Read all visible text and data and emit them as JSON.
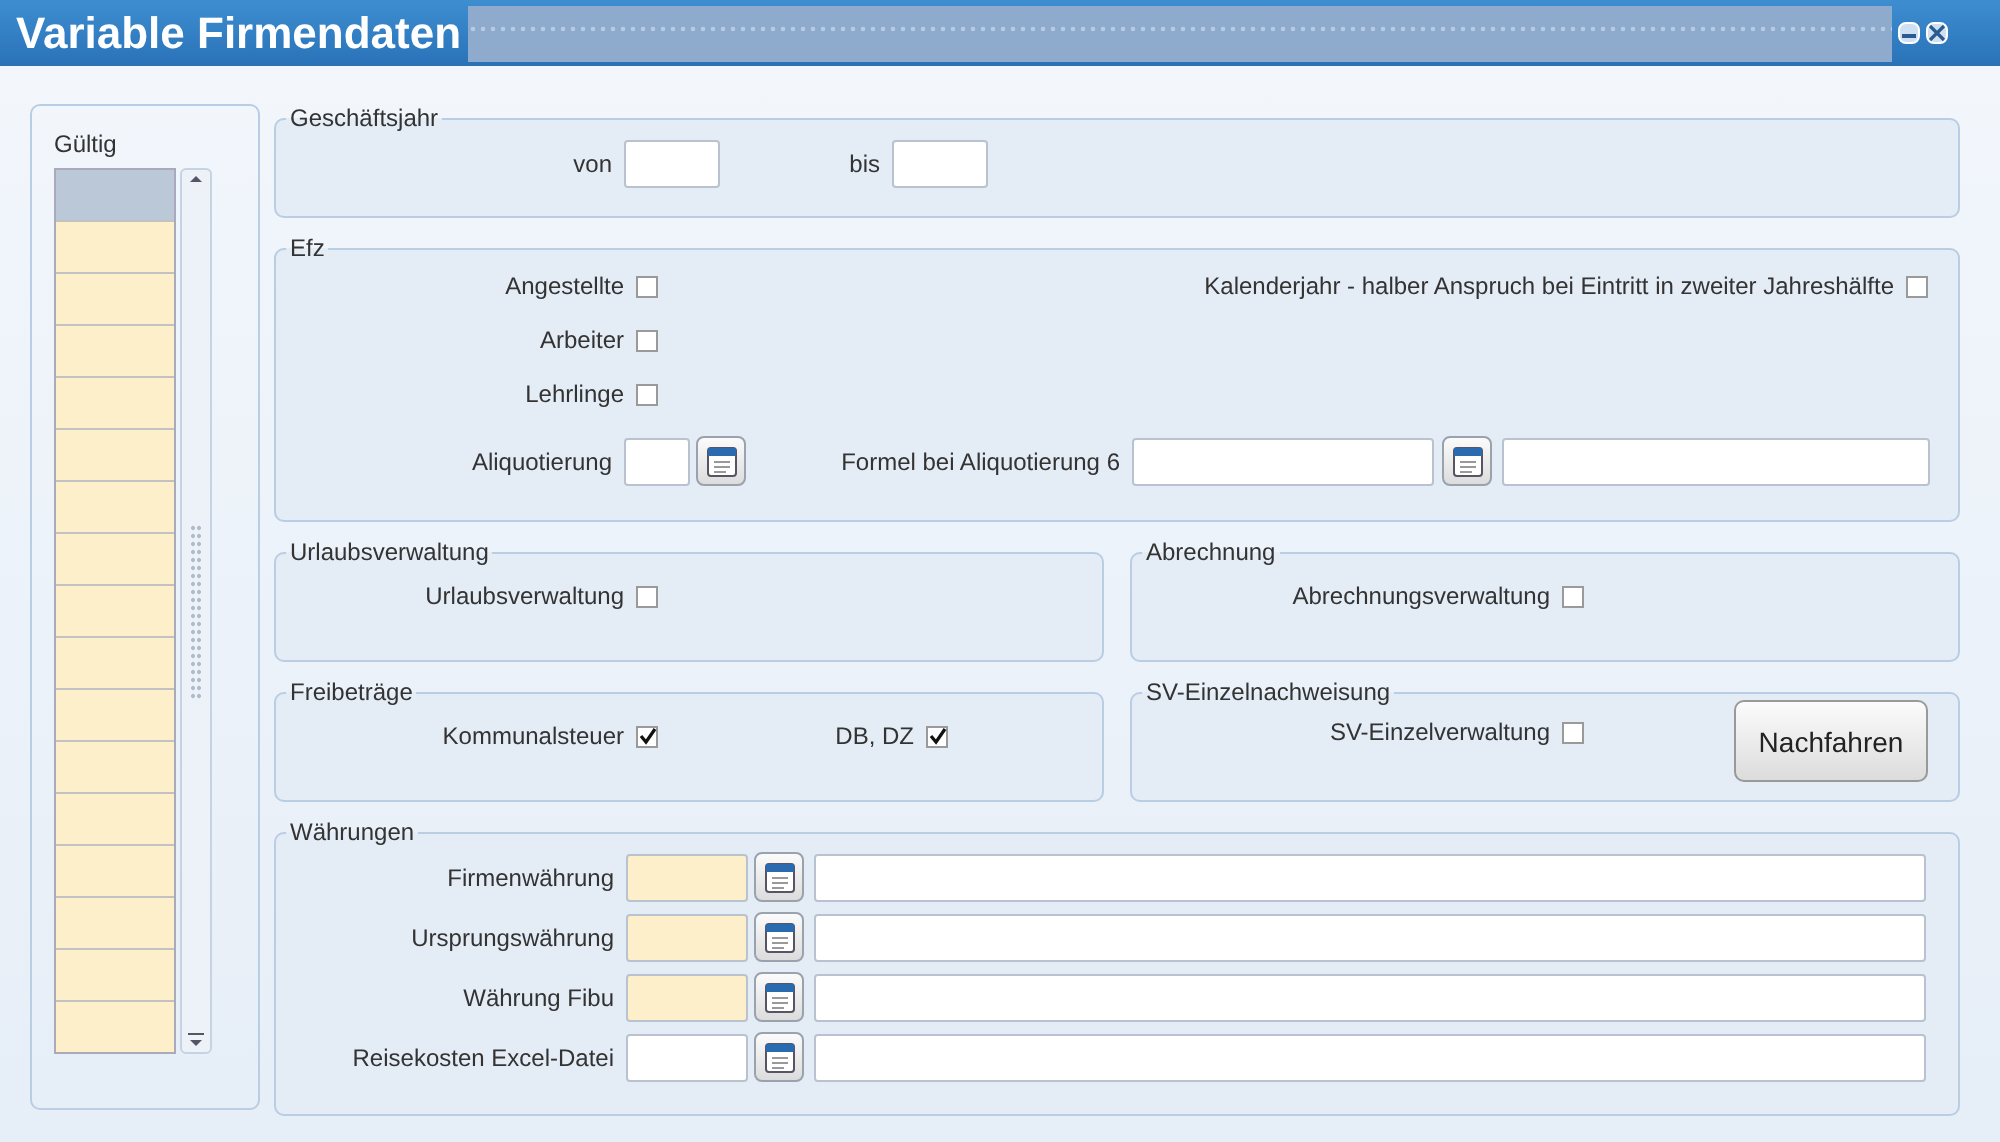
{
  "window": {
    "title": "Variable Firmendaten"
  },
  "valid_list": {
    "header": "Gültig",
    "rows": [
      {
        "selected": true
      },
      {
        "selected": false
      },
      {
        "selected": false
      },
      {
        "selected": false
      },
      {
        "selected": false
      },
      {
        "selected": false
      },
      {
        "selected": false
      },
      {
        "selected": false
      },
      {
        "selected": false
      },
      {
        "selected": false
      },
      {
        "selected": false
      },
      {
        "selected": false
      },
      {
        "selected": false
      },
      {
        "selected": false
      },
      {
        "selected": false
      },
      {
        "selected": false
      },
      {
        "selected": false
      }
    ]
  },
  "geschaeftsjahr": {
    "title": "Geschäftsjahr",
    "fields": [
      {
        "label": "von"
      },
      {
        "label": "bis"
      }
    ]
  },
  "efz": {
    "title": "Efz",
    "checkboxes": [
      {
        "label": "Angestellte",
        "checked": false
      },
      {
        "label": "Arbeiter",
        "checked": false
      },
      {
        "label": "Lehrlinge",
        "checked": false
      }
    ],
    "kalenderjahr": {
      "label": "Kalenderjahr - halber Anspruch bei Eintritt in zweiter Jahreshälfte",
      "checked": false
    },
    "aliquotierung": {
      "label": "Aliquotierung"
    },
    "formel": {
      "label": "Formel bei Aliquotierung 6"
    }
  },
  "urlaubsverwaltung": {
    "title": "Urlaubsverwaltung",
    "checkbox": {
      "label": "Urlaubsverwaltung",
      "checked": false
    }
  },
  "abrechnung": {
    "title": "Abrechnung",
    "checkbox": {
      "label": "Abrechnungsverwaltung",
      "checked": false
    }
  },
  "freibetraege": {
    "title": "Freibeträge",
    "checkboxes": [
      {
        "label": "Kommunalsteuer",
        "checked": true
      },
      {
        "label": "DB, DZ",
        "checked": true
      }
    ]
  },
  "sv": {
    "title": "SV-Einzelnachweisung",
    "checkbox": {
      "label": "SV-Einzelverwaltung",
      "checked": false
    },
    "button": "Nachfahren"
  },
  "waehrungen": {
    "title": "Währungen",
    "rows": [
      {
        "label": "Firmenwährung",
        "required": true
      },
      {
        "label": "Ursprungswährung",
        "required": true
      },
      {
        "label": "Währung Fibu",
        "required": true
      },
      {
        "label": "Reisekosten Excel-Datei",
        "required": false
      }
    ]
  }
}
